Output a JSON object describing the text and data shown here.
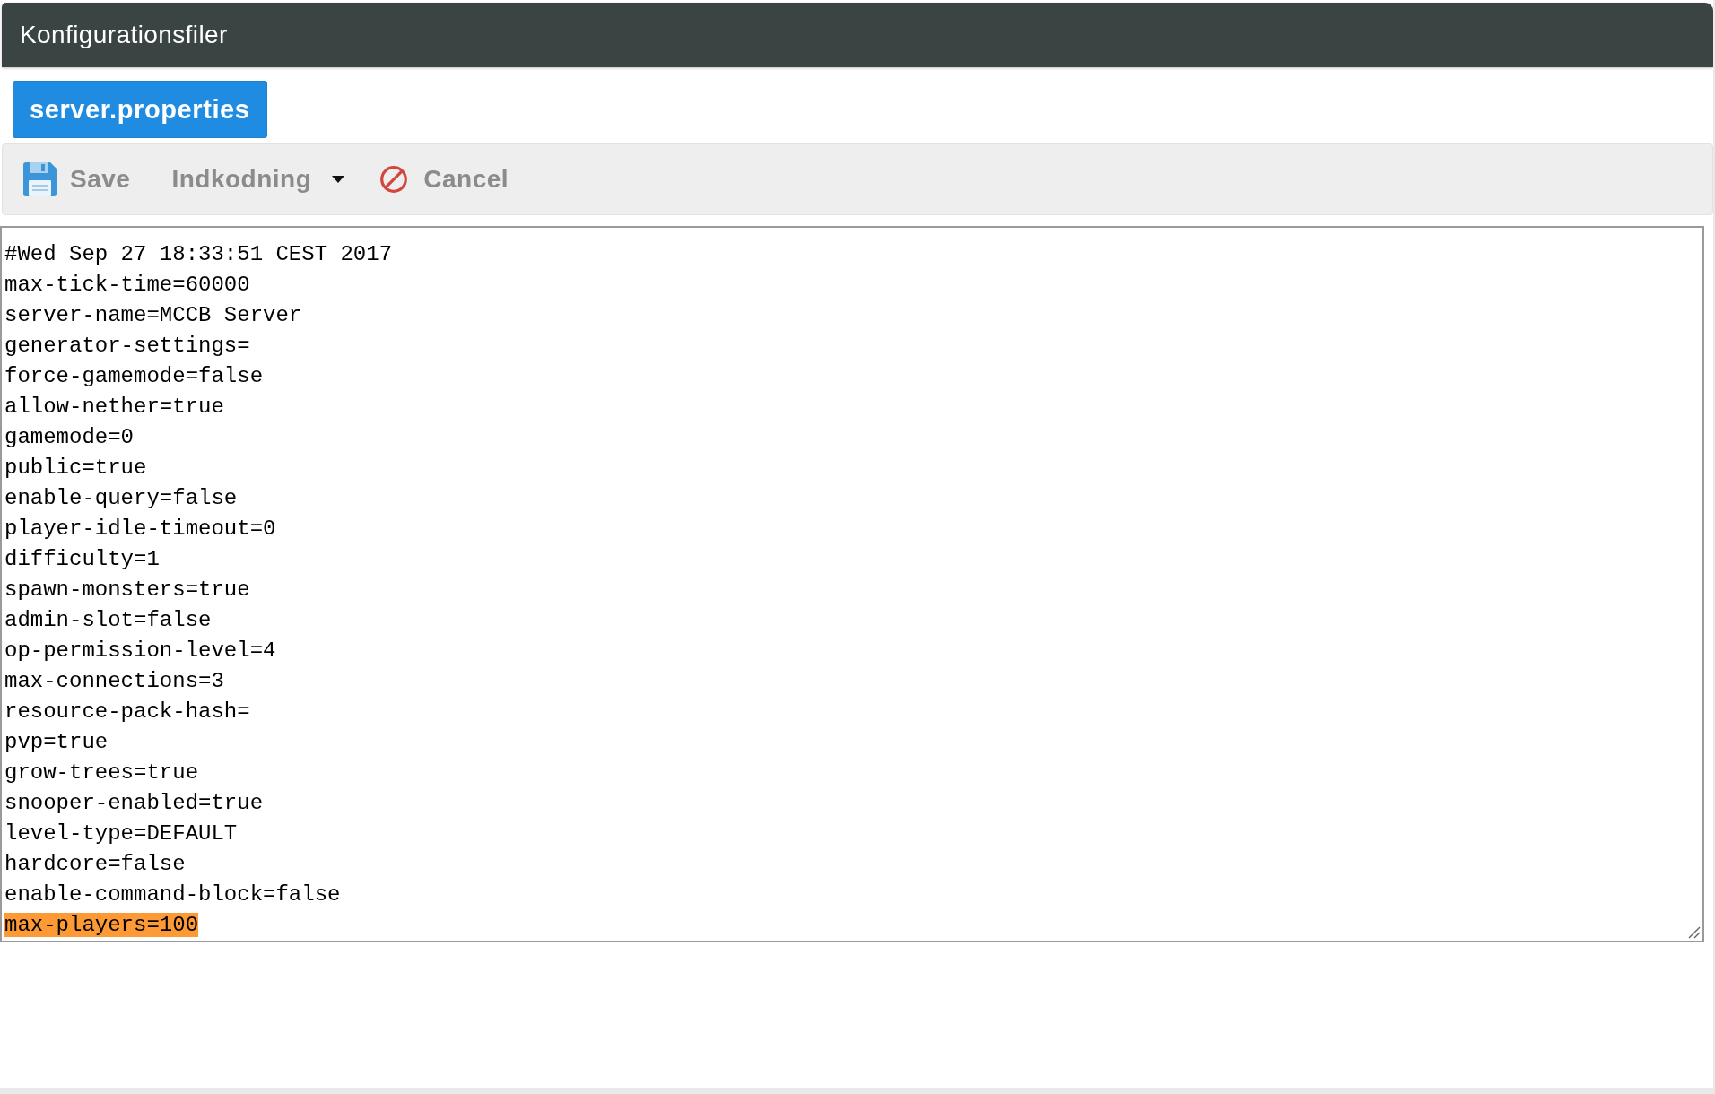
{
  "header": {
    "title": "Konfigurationsfiler"
  },
  "tabs": [
    {
      "label": "server.properties",
      "selected": true
    }
  ],
  "toolbar": [
    {
      "kind": "save",
      "label": "Save"
    },
    {
      "kind": "dropdown",
      "label": "Indkodning"
    },
    {
      "kind": "cancel",
      "label": "Cancel"
    }
  ],
  "editor": {
    "lines": [
      {
        "text": "#Wed Sep 27 18:33:51 CEST 2017",
        "selected": false
      },
      {
        "text": "max-tick-time=60000",
        "selected": false
      },
      {
        "text": "server-name=MCCB Server",
        "selected": false
      },
      {
        "text": "generator-settings=",
        "selected": false
      },
      {
        "text": "force-gamemode=false",
        "selected": false
      },
      {
        "text": "allow-nether=true",
        "selected": false
      },
      {
        "text": "gamemode=0",
        "selected": false
      },
      {
        "text": "public=true",
        "selected": false
      },
      {
        "text": "enable-query=false",
        "selected": false
      },
      {
        "text": "player-idle-timeout=0",
        "selected": false
      },
      {
        "text": "difficulty=1",
        "selected": false
      },
      {
        "text": "spawn-monsters=true",
        "selected": false
      },
      {
        "text": "admin-slot=false",
        "selected": false
      },
      {
        "text": "op-permission-level=4",
        "selected": false
      },
      {
        "text": "max-connections=3",
        "selected": false
      },
      {
        "text": "resource-pack-hash=",
        "selected": false
      },
      {
        "text": "pvp=true",
        "selected": false
      },
      {
        "text": "grow-trees=true",
        "selected": false
      },
      {
        "text": "snooper-enabled=true",
        "selected": false
      },
      {
        "text": "level-type=DEFAULT",
        "selected": false
      },
      {
        "text": "hardcore=false",
        "selected": false
      },
      {
        "text": "enable-command-block=false",
        "selected": false
      },
      {
        "text": "max-players=100",
        "selected": true
      }
    ]
  }
}
